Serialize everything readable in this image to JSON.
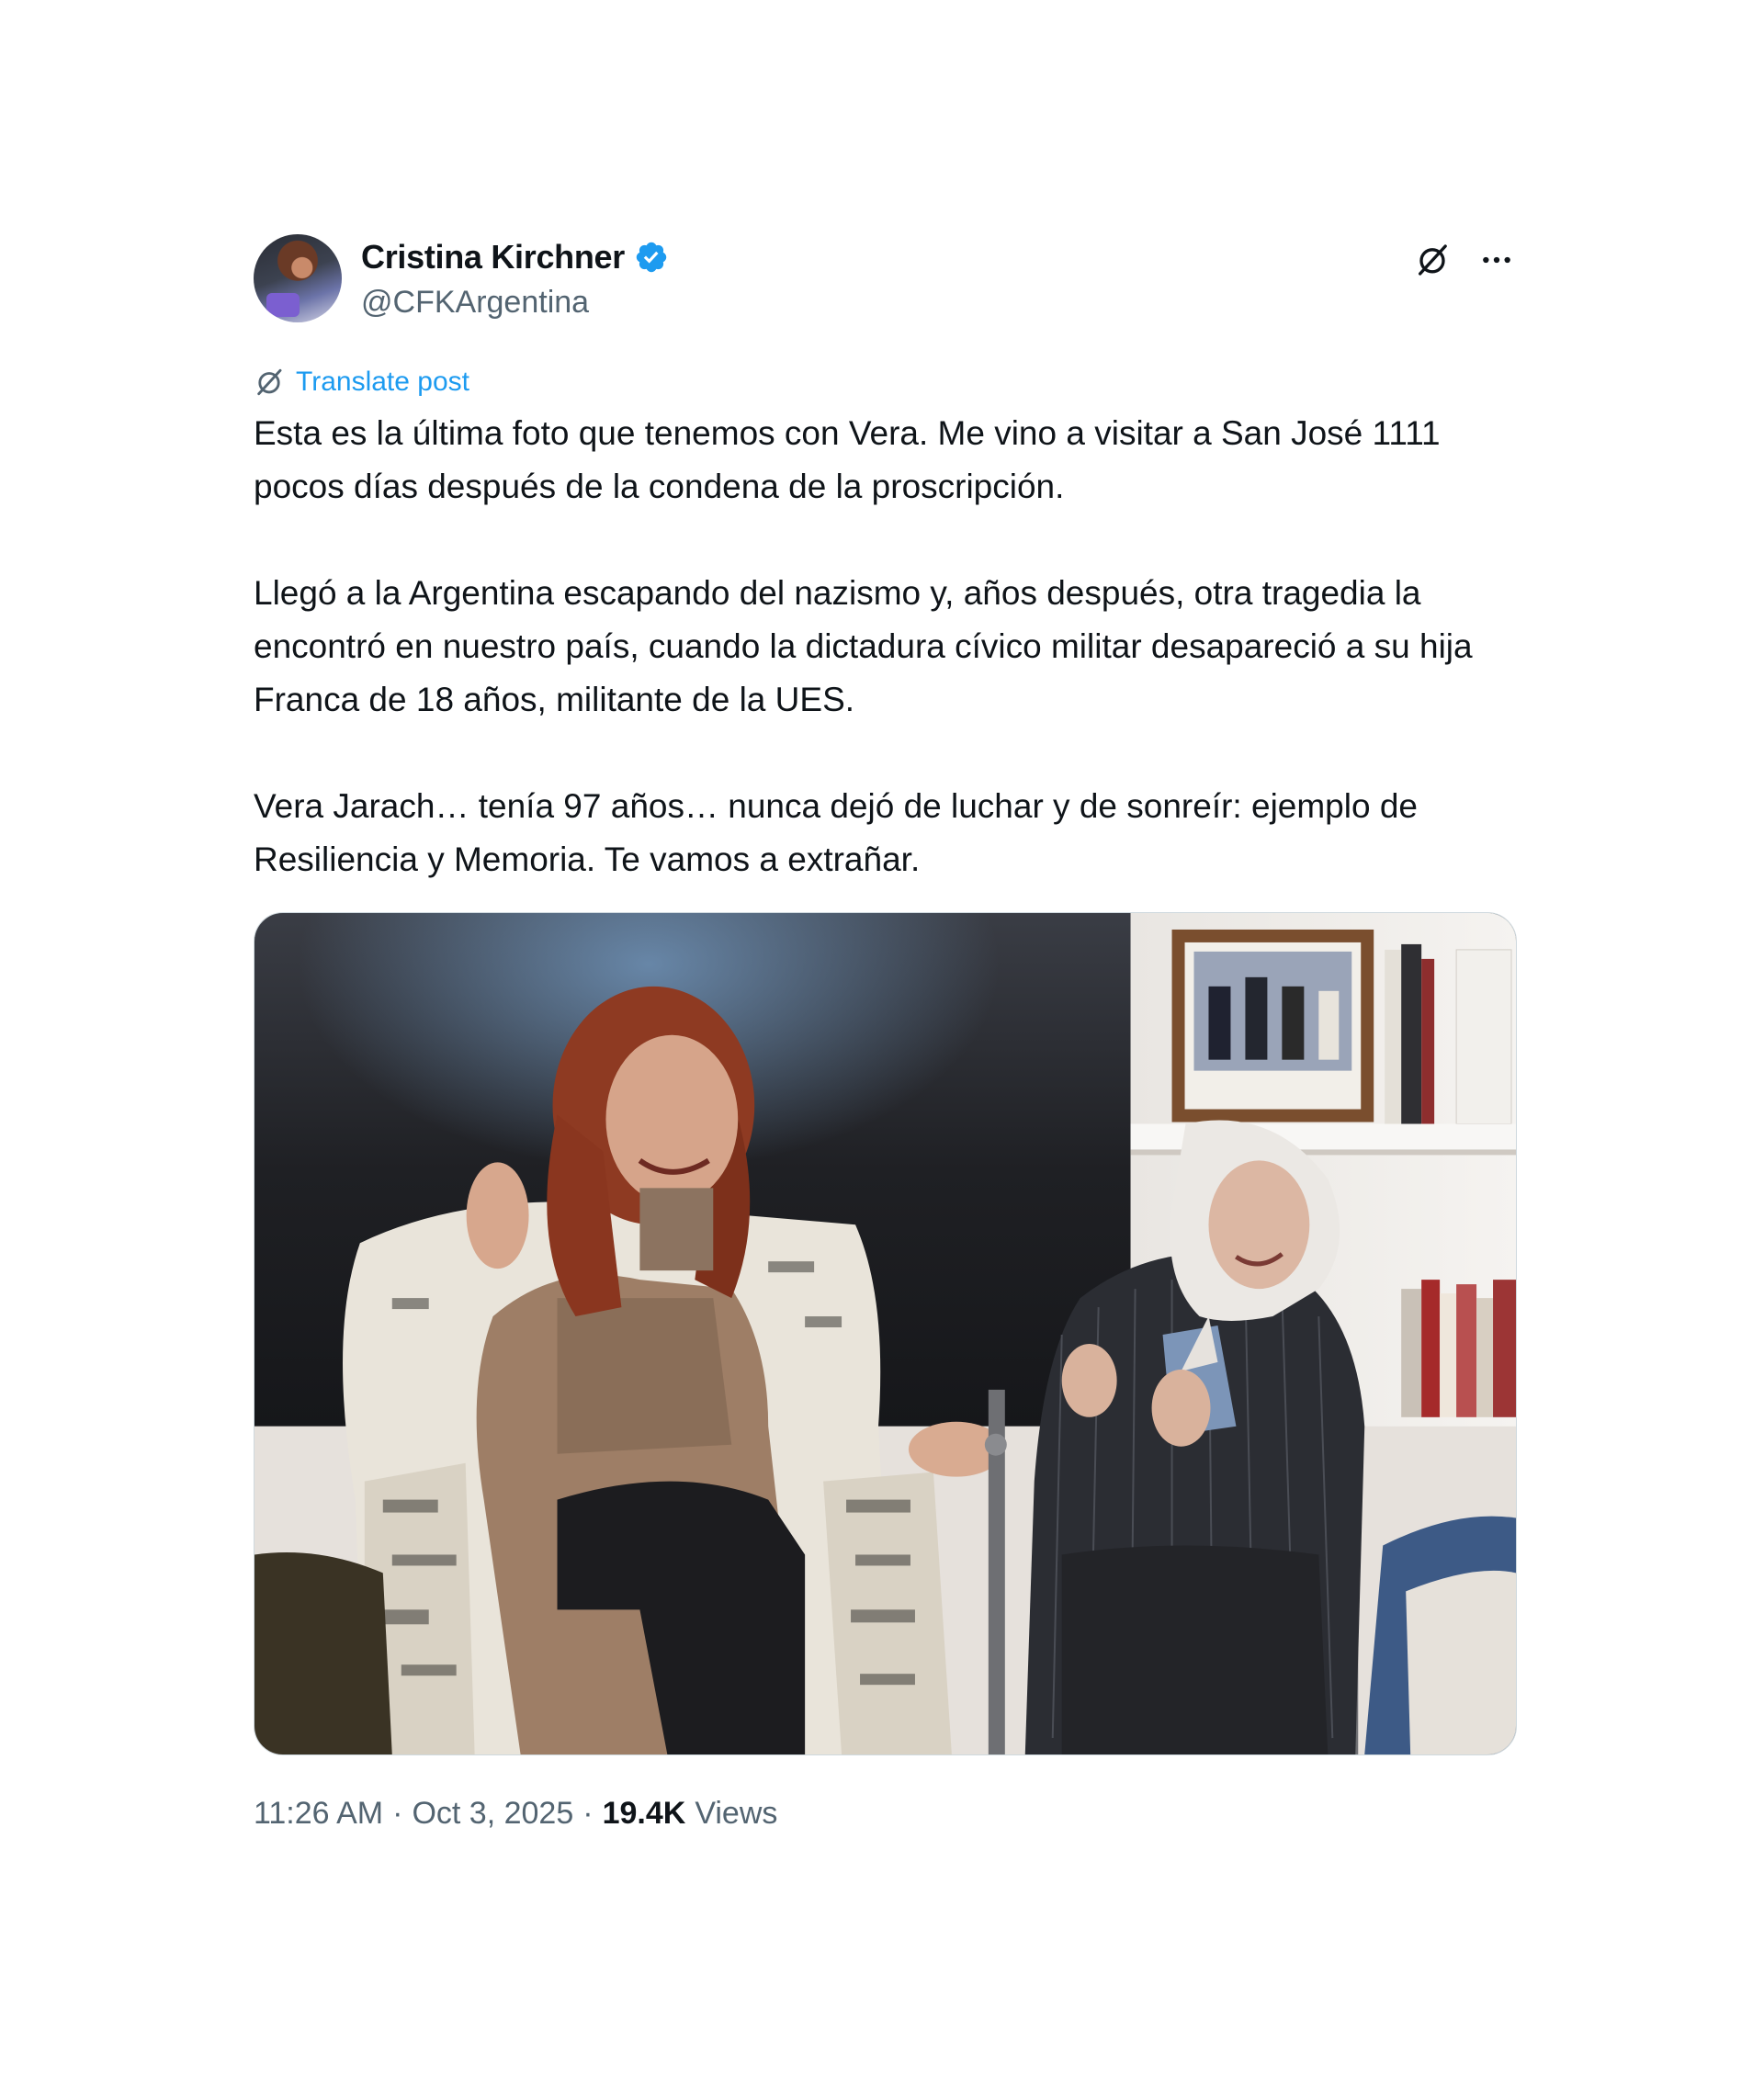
{
  "author": {
    "display_name": "Cristina Kirchner",
    "handle": "@CFKArgentina",
    "verified": true
  },
  "header_icons": [
    "grok-icon",
    "more-options-icon"
  ],
  "translate_label": "Translate post",
  "body": {
    "p1": "Esta es la última foto que tenemos con Vera. Me vino a visitar a San José 1111 pocos días después de la condena de la proscripción.",
    "p2": "Llegó a la Argentina escapando del nazismo y, años después, otra tragedia la encontró en nuestro país, cuando la dictadura cívico militar desapareció a su hija Franca de 18 años, militante de la UES.",
    "p3": "Vera Jarach… tenía 97 años… nunca dejó de luchar y de sonreír: ejemplo de Resiliencia y Memoria. Te vamos a extrañar."
  },
  "meta": {
    "time": "11:26 AM",
    "date": "Oct 3, 2025",
    "views_count": "19.4K",
    "views_label": "Views"
  },
  "colors": {
    "accent": "#1d9bf0",
    "text": "#0f1419",
    "secondary": "#536471"
  }
}
